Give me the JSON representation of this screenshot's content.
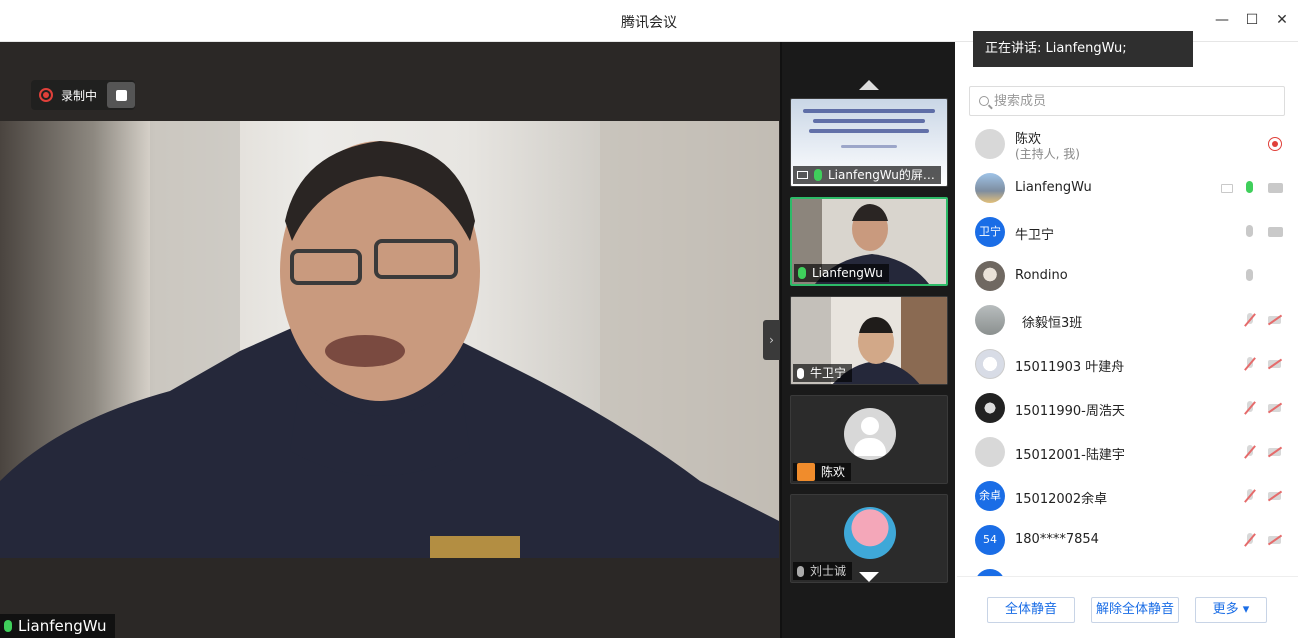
{
  "window": {
    "title": "腾讯会议"
  },
  "stage": {
    "recording_label": "录制中",
    "main_speaker_name": "LianfengWu"
  },
  "thumbnails": [
    {
      "label": "LianfengWu的屏…",
      "type": "screen-share"
    },
    {
      "label": "LianfengWu",
      "type": "video",
      "mic": "speaking"
    },
    {
      "label": "牛卫宁",
      "type": "video",
      "mic": "on"
    },
    {
      "label": "陈欢",
      "type": "avatar"
    },
    {
      "label": "刘士诚",
      "type": "avatar"
    }
  ],
  "panel": {
    "speaking_banner": "正在讲话: LianfengWu;",
    "search_placeholder": "搜索成员",
    "members": [
      {
        "name": "陈欢",
        "sub": "(主持人, 我)",
        "avatar_text": "",
        "status": "recording"
      },
      {
        "name": "LianfengWu",
        "avatar_text": "",
        "mic": "speaking",
        "camera": "on",
        "sharing": true
      },
      {
        "name": "牛卫宁",
        "avatar_text": "卫宁",
        "mic": "on",
        "camera": "on"
      },
      {
        "name": "Rondino",
        "avatar_text": "",
        "mic": "on"
      },
      {
        "name": "徐毅恒3班",
        "avatar_text": "",
        "mic": "muted",
        "camera": "off"
      },
      {
        "name": "15011903 叶建舟",
        "avatar_text": "",
        "mic": "muted",
        "camera": "off"
      },
      {
        "name": "15011990-周浩天",
        "avatar_text": "",
        "mic": "muted",
        "camera": "off"
      },
      {
        "name": "15012001-陆建宇",
        "avatar_text": "",
        "mic": "muted",
        "camera": "off"
      },
      {
        "name": "15012002余卓",
        "avatar_text": "余卓",
        "mic": "muted",
        "camera": "off"
      },
      {
        "name": "180****7854",
        "avatar_text": "54",
        "mic": "muted",
        "camera": "off"
      }
    ],
    "footer": {
      "mute_all": "全体静音",
      "unmute_all": "解除全体静音",
      "more": "更多 ▾"
    }
  },
  "colors": {
    "accent": "#1a6de6",
    "speaking_green": "#3fcf5b",
    "record_red": "#e0403a"
  }
}
